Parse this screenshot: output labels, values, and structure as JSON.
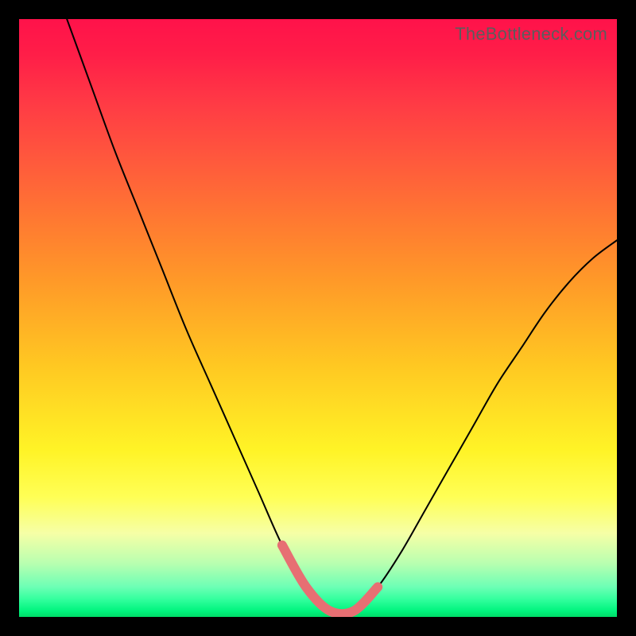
{
  "watermark": "TheBottleneck.com",
  "colors": {
    "frame": "#000000",
    "curve": "#000000",
    "accent": "#e76f73",
    "watermark": "#5c5c5c"
  },
  "chart_data": {
    "type": "line",
    "title": "",
    "xlabel": "",
    "ylabel": "",
    "xlim": [
      0,
      100
    ],
    "ylim": [
      0,
      100
    ],
    "grid": false,
    "gradient_stops": [
      {
        "pos": 0,
        "color": "#ff124a"
      },
      {
        "pos": 14,
        "color": "#ff3a45"
      },
      {
        "pos": 34,
        "color": "#ff7a31"
      },
      {
        "pos": 58,
        "color": "#ffc822"
      },
      {
        "pos": 80,
        "color": "#ffff56"
      },
      {
        "pos": 95,
        "color": "#6cffb5"
      },
      {
        "pos": 100,
        "color": "#00db67"
      }
    ],
    "series": [
      {
        "name": "bottleneck-curve",
        "x": [
          8,
          12,
          16,
          20,
          24,
          28,
          32,
          36,
          40,
          44,
          48,
          52,
          56,
          60,
          64,
          68,
          72,
          76,
          80,
          84,
          88,
          92,
          96,
          100
        ],
        "y": [
          100,
          89,
          78,
          68,
          58,
          48,
          39,
          30,
          21,
          12,
          5,
          1,
          1,
          5,
          11,
          18,
          25,
          32,
          39,
          45,
          51,
          56,
          60,
          63
        ]
      }
    ],
    "accent_segment": {
      "name": "selected-range",
      "x": [
        44,
        48,
        52,
        56,
        60
      ],
      "y": [
        12,
        5,
        1,
        1,
        5
      ]
    }
  }
}
